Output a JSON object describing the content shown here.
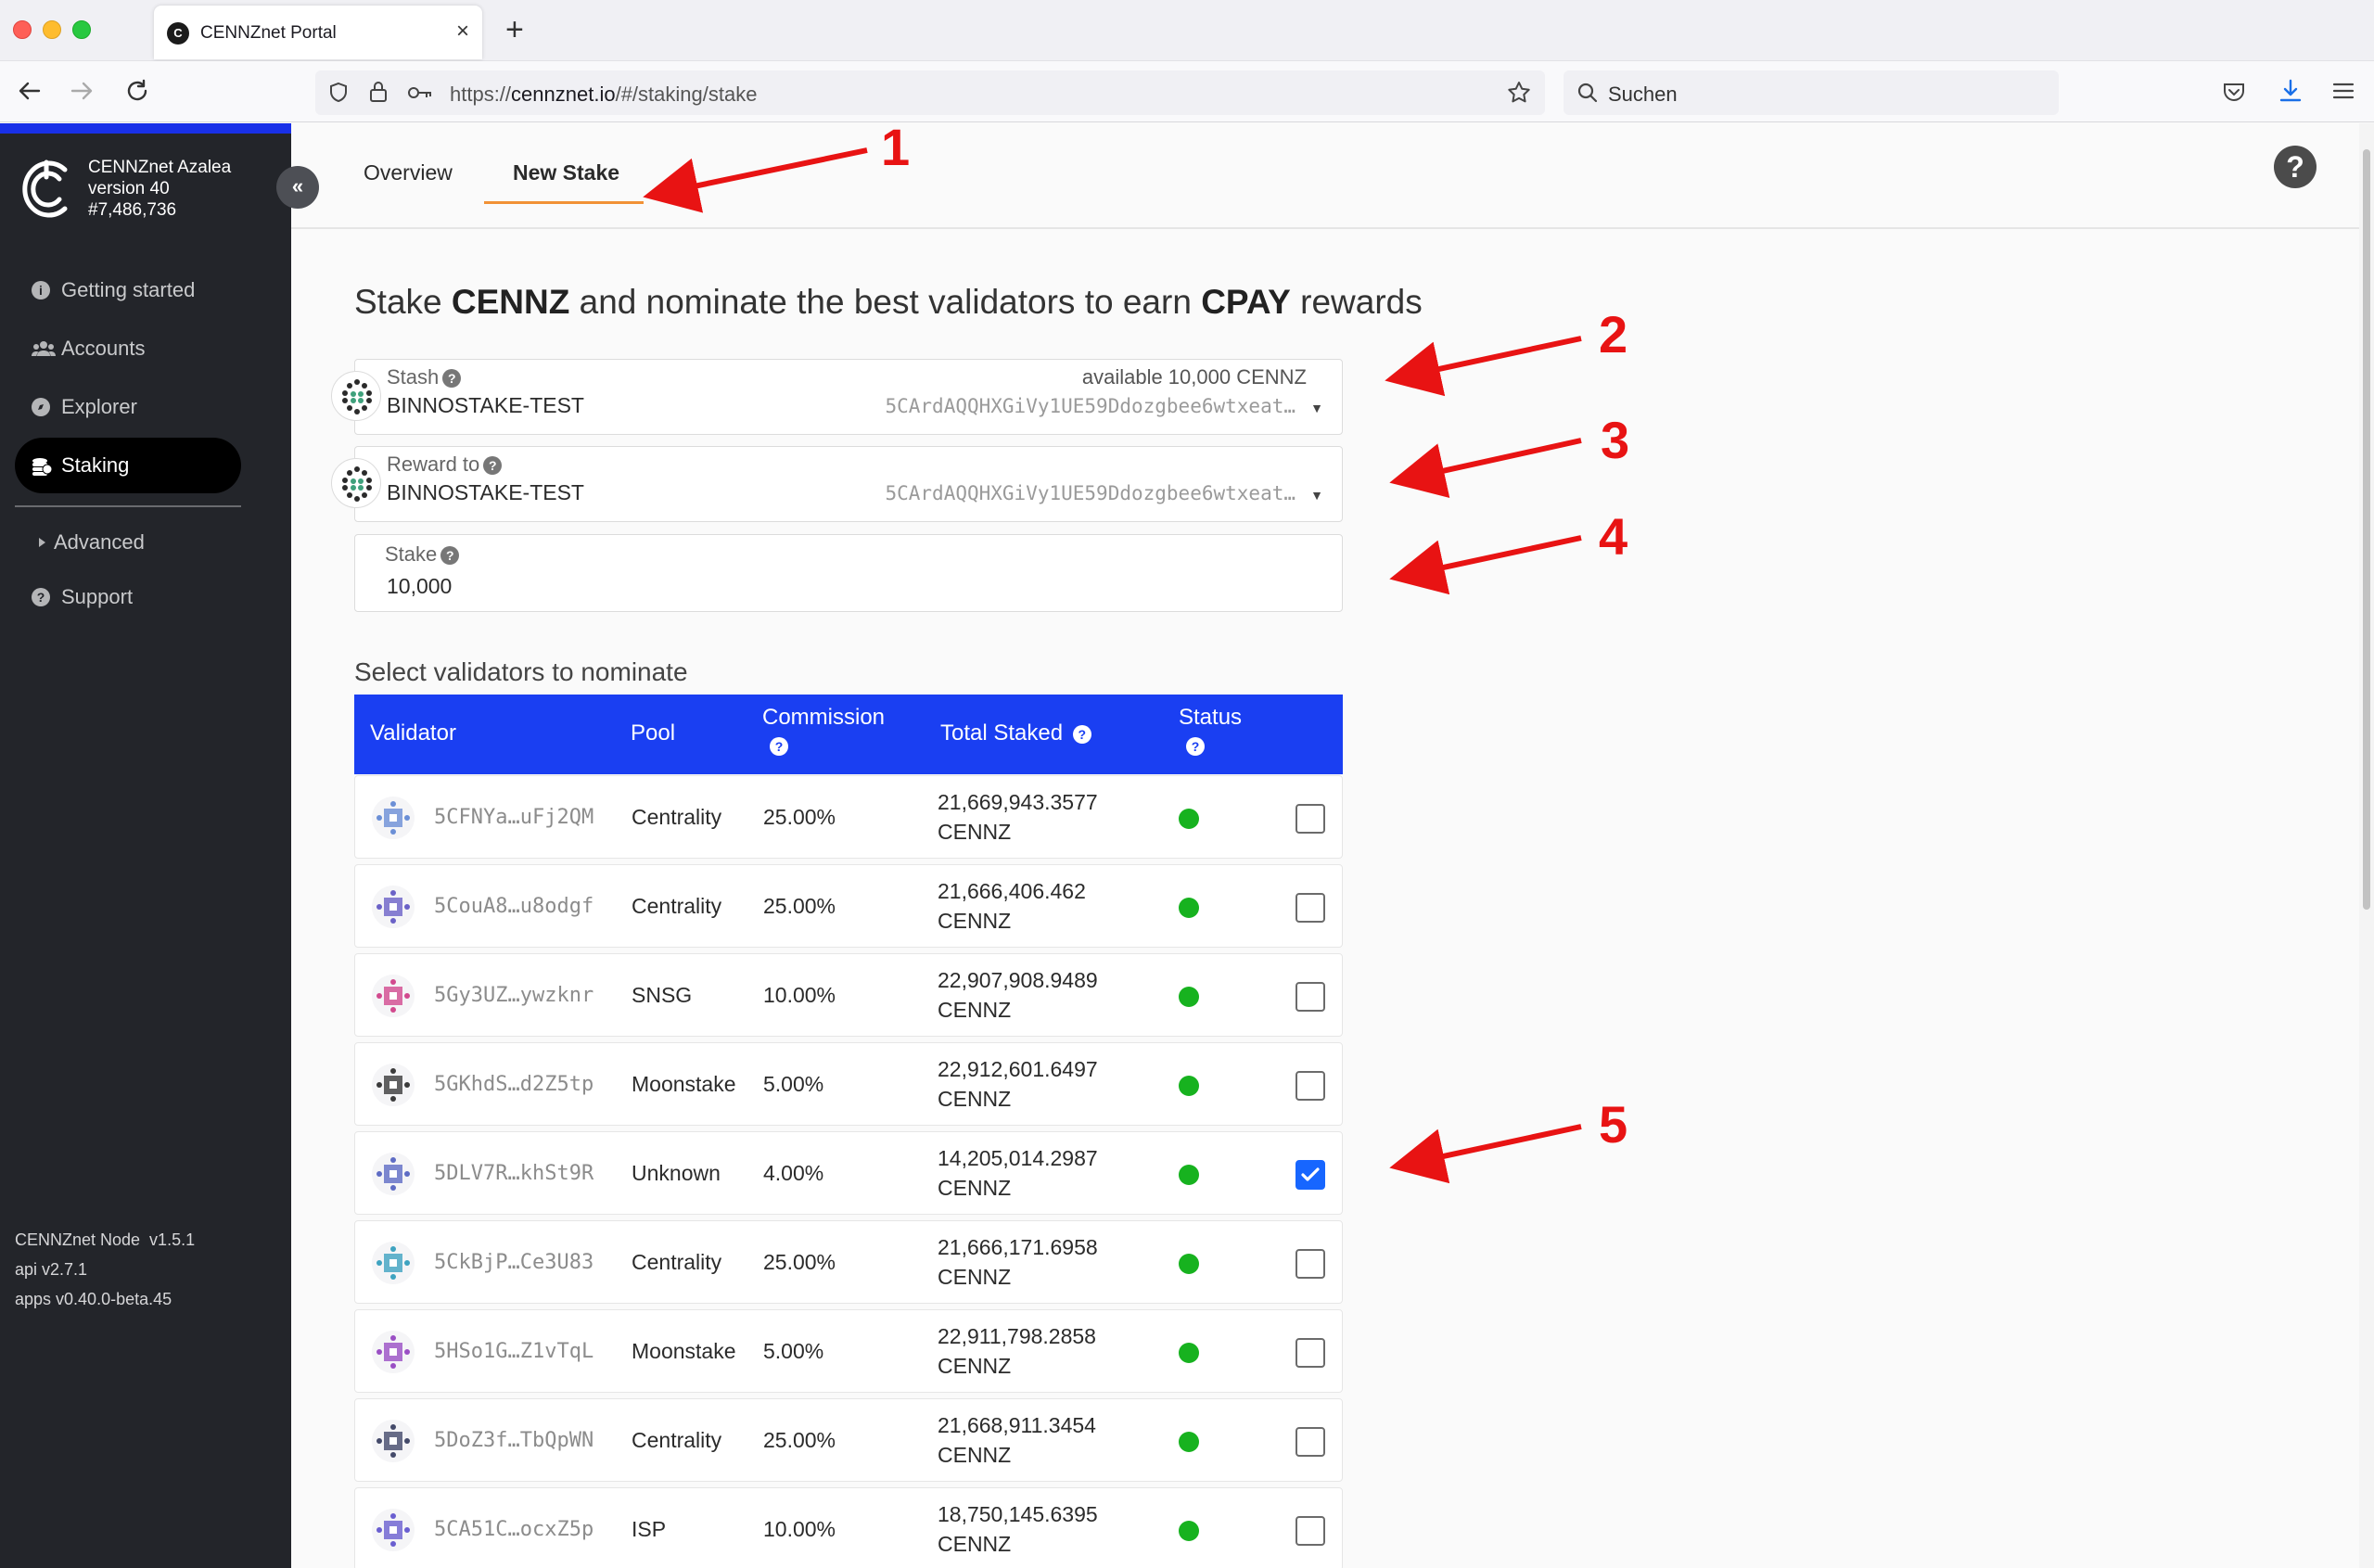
{
  "browser": {
    "tab_title": "CENNZnet Portal",
    "tab_close": "×",
    "new_tab": "+",
    "url_prefix": "https://",
    "url_host": "cennznet.io",
    "url_path": "/#/staking/stake",
    "search_placeholder": "Suchen"
  },
  "sidebar": {
    "chain_name": "CENNZnet Azalea",
    "version": "version 40",
    "block": "#7,486,736",
    "collapse_glyph": "«",
    "items": [
      {
        "label": "Getting started",
        "icon": "info-icon"
      },
      {
        "label": "Accounts",
        "icon": "users-icon"
      },
      {
        "label": "Explorer",
        "icon": "compass-icon"
      },
      {
        "label": "Staking",
        "icon": "coins-icon"
      },
      {
        "label": "Advanced",
        "icon": "triangle-right-icon"
      },
      {
        "label": "Support",
        "icon": "question-icon"
      }
    ],
    "footer": {
      "node": "CENNZnet Node  v1.5.1",
      "api": "api v2.7.1",
      "apps": "apps v0.40.0-beta.45"
    }
  },
  "tabs": {
    "overview": "Overview",
    "new_stake": "New Stake",
    "help_glyph": "?"
  },
  "heading": {
    "part1": "Stake ",
    "token1": "CENNZ",
    "part2": " and nominate the best validators to earn ",
    "token2": "CPAY",
    "part3": " rewards"
  },
  "form": {
    "stash": {
      "label": "Stash",
      "name": "BINNOSTAKE-TEST",
      "available": "available 10,000 CENNZ",
      "address": "5CArdAQQHXGiVy1UE59Ddozgbee6wtxeat…"
    },
    "reward_to": {
      "label": "Reward to",
      "name": "BINNOSTAKE-TEST",
      "address": "5CArdAQQHXGiVy1UE59Ddozgbee6wtxeat…"
    },
    "stake": {
      "label": "Stake",
      "value": "10,000"
    }
  },
  "validators": {
    "section_label": "Select validators to nominate",
    "headers": {
      "validator": "Validator",
      "pool": "Pool",
      "commission": "Commission",
      "total_staked": "Total Staked",
      "status": "Status"
    },
    "rows": [
      {
        "address": "5CFNYa…uFj2QM",
        "pool": "Centrality",
        "commission": "25.00%",
        "staked": "21,669,943.3577",
        "unit": "CENNZ",
        "status": "active",
        "checked": false
      },
      {
        "address": "5CouA8…u8odgf",
        "pool": "Centrality",
        "commission": "25.00%",
        "staked": "21,666,406.462",
        "unit": "CENNZ",
        "status": "active",
        "checked": false
      },
      {
        "address": "5Gy3UZ…ywzknr",
        "pool": "SNSG",
        "commission": "10.00%",
        "staked": "22,907,908.9489",
        "unit": "CENNZ",
        "status": "active",
        "checked": false
      },
      {
        "address": "5GKhdS…d2Z5tp",
        "pool": "Moonstake",
        "commission": "5.00%",
        "staked": "22,912,601.6497",
        "unit": "CENNZ",
        "status": "active",
        "checked": false
      },
      {
        "address": "5DLV7R…khSt9R",
        "pool": "Unknown",
        "commission": "4.00%",
        "staked": "14,205,014.2987",
        "unit": "CENNZ",
        "status": "active",
        "checked": true
      },
      {
        "address": "5CkBjP…Ce3U83",
        "pool": "Centrality",
        "commission": "25.00%",
        "staked": "21,666,171.6958",
        "unit": "CENNZ",
        "status": "active",
        "checked": false
      },
      {
        "address": "5HSo1G…Z1vTqL",
        "pool": "Moonstake",
        "commission": "5.00%",
        "staked": "22,911,798.2858",
        "unit": "CENNZ",
        "status": "active",
        "checked": false
      },
      {
        "address": "5DoZ3f…TbQpWN",
        "pool": "Centrality",
        "commission": "25.00%",
        "staked": "21,668,911.3454",
        "unit": "CENNZ",
        "status": "active",
        "checked": false
      },
      {
        "address": "5CA51C…ocxZ5p",
        "pool": "ISP",
        "commission": "10.00%",
        "staked": "18,750,145.6395",
        "unit": "CENNZ",
        "status": "active",
        "checked": false
      }
    ]
  },
  "annotations": [
    "1",
    "2",
    "3",
    "4",
    "5"
  ],
  "colors": {
    "accent": "#1a3ff2",
    "tab_underline": "#f19135",
    "status_active": "#17b21f",
    "annotation": "#e81313",
    "sidebar_bg": "#23252a"
  }
}
